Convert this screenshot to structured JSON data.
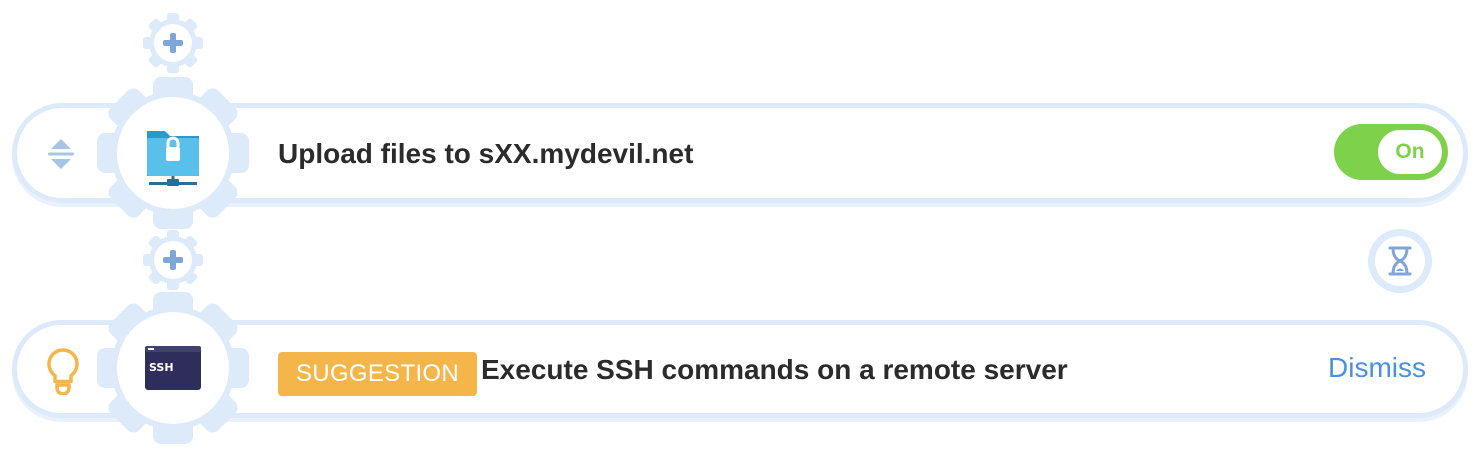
{
  "steps": [
    {
      "title": "Upload files to sXX.mydevil.net",
      "app_icon": "ftp-folder-lock-icon",
      "toggle": {
        "label": "On",
        "state": "on"
      }
    },
    {
      "badge": "SUGGESTION",
      "title": "Execute SSH commands on a remote server",
      "app_icon": "ssh-terminal-icon",
      "app_icon_text": "SSH",
      "action_label": "Dismiss"
    }
  ],
  "colors": {
    "gear": "#dceafa",
    "plus": "#7ea6d8",
    "toggle_on": "#7ed14b",
    "badge": "#f4b54a",
    "link": "#4a90e2",
    "bulb": "#f4b54a",
    "folder": "#4fb9e6",
    "terminal": "#2f2d5b"
  }
}
